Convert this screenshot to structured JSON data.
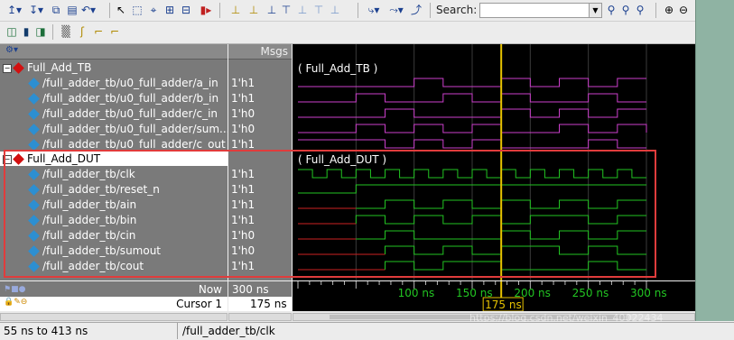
{
  "toolbar": {
    "search_label": "Search:",
    "search_value": ""
  },
  "names_header": {
    "msgs": "Msgs"
  },
  "groups": [
    {
      "name": "Full_Add_TB",
      "wave_label": "( Full_Add_TB )"
    },
    {
      "name": "Full_Add_DUT",
      "wave_label": "( Full_Add_DUT )"
    }
  ],
  "signals_tb": [
    {
      "name": "/full_adder_tb/u0_full_adder/a_in",
      "value": "1'h1"
    },
    {
      "name": "/full_adder_tb/u0_full_adder/b_in",
      "value": "1'h1"
    },
    {
      "name": "/full_adder_tb/u0_full_adder/c_in",
      "value": "1'h0"
    },
    {
      "name": "/full_adder_tb/u0_full_adder/sum...",
      "value": "1'h0"
    },
    {
      "name": "/full_adder_tb/u0_full_adder/c_out",
      "value": "1'h1"
    }
  ],
  "signals_dut": [
    {
      "name": "/full_adder_tb/clk",
      "value": "1'h1"
    },
    {
      "name": "/full_adder_tb/reset_n",
      "value": "1'h1"
    },
    {
      "name": "/full_adder_tb/ain",
      "value": "1'h1"
    },
    {
      "name": "/full_adder_tb/bin",
      "value": "1'h1"
    },
    {
      "name": "/full_adder_tb/cin",
      "value": "1'h0"
    },
    {
      "name": "/full_adder_tb/sumout",
      "value": "1'h0"
    },
    {
      "name": "/full_adder_tb/cout",
      "value": "1'h1"
    }
  ],
  "cursors": {
    "now_label": "Now",
    "now_value": "300 ns",
    "cursor1_label": "Cursor 1",
    "cursor1_value": "175 ns",
    "cursor1_time": "175 ns"
  },
  "timeline": {
    "ticks": [
      "100 ns",
      "150 ns",
      "200 ns",
      "250 ns",
      "300 ns"
    ],
    "tick_values_ns": [
      100,
      150,
      200,
      250,
      300
    ],
    "view_start_ns": 55,
    "view_end_ns": 413,
    "cursor_ns": 175
  },
  "status": {
    "range": "55 ns to 413 ns",
    "selected": "/full_adder_tb/clk"
  },
  "watermark": "https://blog.csdn.net/weixin_40022434",
  "colors": {
    "tb_wave": "#cc3fcc",
    "dut_wave": "#22c522",
    "undefined_wave": "#cc2222",
    "cursor": "#e6c200",
    "highlight_box": "#e03c3c"
  }
}
